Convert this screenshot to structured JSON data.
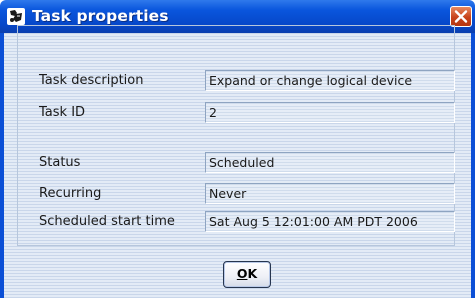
{
  "window": {
    "title": "Task properties",
    "app_icon": "task-properties-icon",
    "close_icon": "close-icon"
  },
  "colors": {
    "titlebar": "#0a56dd",
    "frame": "#0b4fd6",
    "close_button": "#c7421a",
    "background": "#dfe8f5"
  },
  "fields": [
    {
      "label": "Task description",
      "value": "Expand or change logical device"
    },
    {
      "label": "Task ID",
      "value": "2"
    },
    {
      "label": "Status",
      "value": "Scheduled"
    },
    {
      "label": "Recurring",
      "value": "Never"
    },
    {
      "label": "Scheduled start time",
      "value": "Sat Aug 5 12:01:00 AM PDT 2006"
    }
  ],
  "ok_button": {
    "mnemonic": "O",
    "rest": "K"
  }
}
